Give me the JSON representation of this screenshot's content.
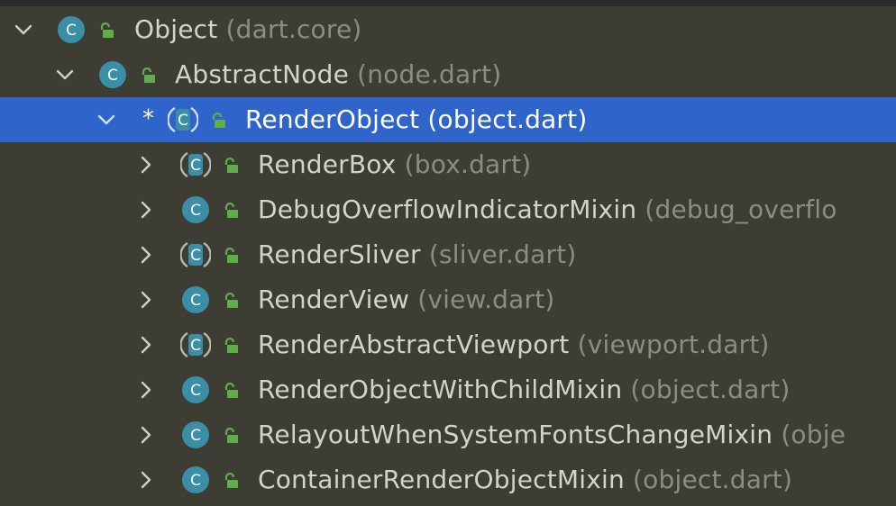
{
  "tree": {
    "nodes": [
      {
        "name": "Object",
        "file": "(dart.core)",
        "expanded": true,
        "abstract": false,
        "selected": false
      },
      {
        "name": "AbstractNode",
        "file": "(node.dart)",
        "expanded": true,
        "abstract": false,
        "selected": false
      },
      {
        "name": "RenderObject",
        "file": "(object.dart)",
        "expanded": true,
        "abstract": true,
        "selected": true,
        "marker": "*"
      },
      {
        "name": "RenderBox",
        "file": "(box.dart)",
        "expanded": false,
        "abstract": true,
        "selected": false
      },
      {
        "name": "DebugOverflowIndicatorMixin",
        "file": "(debug_overflo",
        "expanded": false,
        "abstract": false,
        "selected": false
      },
      {
        "name": "RenderSliver",
        "file": "(sliver.dart)",
        "expanded": false,
        "abstract": true,
        "selected": false
      },
      {
        "name": "RenderView",
        "file": "(view.dart)",
        "expanded": false,
        "abstract": false,
        "selected": false
      },
      {
        "name": "RenderAbstractViewport",
        "file": "(viewport.dart)",
        "expanded": false,
        "abstract": true,
        "selected": false
      },
      {
        "name": "RenderObjectWithChildMixin",
        "file": "(object.dart)",
        "expanded": false,
        "abstract": false,
        "selected": false
      },
      {
        "name": "RelayoutWhenSystemFontsChangeMixin",
        "file": "(obje",
        "expanded": false,
        "abstract": false,
        "selected": false
      },
      {
        "name": "ContainerRenderObjectMixin",
        "file": "(object.dart)",
        "expanded": false,
        "abstract": false,
        "selected": false
      }
    ],
    "icon_letter": "C",
    "icons": {
      "class": "class-icon",
      "abstract_class": "abstract-class-icon",
      "visibility": "public-lock-icon",
      "expanded": "chevron-down-icon",
      "collapsed": "chevron-right-icon"
    }
  },
  "colors": {
    "background": "#3e3d34",
    "selection": "#2f65ca",
    "class_icon": "#3a8ea6",
    "lock_icon": "#5eae4a",
    "name_text": "#d3d3cb",
    "file_text": "#8c8c86"
  }
}
